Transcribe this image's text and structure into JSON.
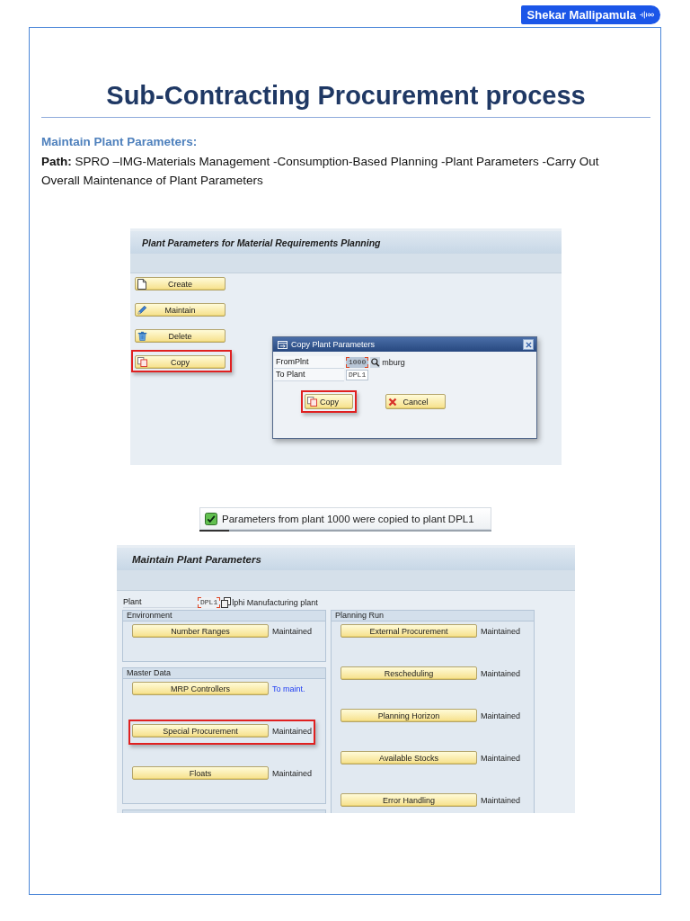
{
  "badge": {
    "text": "Shekar Mallipamula"
  },
  "title": "Sub-Contracting Procurement process",
  "section": {
    "heading": "Maintain Plant Parameters:",
    "path": "**Path:** SPRO –IMG-Materials Management -Consumption-Based Planning -Plant Parameters -Carry Out Overall Maintenance of Plant Parameters"
  },
  "screen_1": {
    "title": "Plant Parameters for Material Requirements Planning",
    "buttons": [
      {
        "label": "Create",
        "kind": "create",
        "highlighted": false
      },
      {
        "label": "Maintain",
        "kind": "maintain",
        "highlighted": false
      },
      {
        "label": "Delete",
        "kind": "delete",
        "highlighted": false
      },
      {
        "label": "Copy",
        "kind": "copy",
        "highlighted": true
      }
    ],
    "dialog": {
      "title": "Copy Plant Parameters",
      "fields": [
        {
          "label": "FromPlnt",
          "value": "1000",
          "focused": true,
          "text_selected": true,
          "value_help": true,
          "description": "mburg"
        },
        {
          "label": "To Plant",
          "value": "DPL1",
          "focused": false,
          "text_selected": false,
          "value_help": false
        }
      ],
      "buttons": [
        {
          "label": "Copy",
          "kind": "copy",
          "highlighted": true
        },
        {
          "label": "Cancel",
          "kind": "cancel",
          "highlighted": false
        }
      ]
    }
  },
  "message": {
    "kind": "success",
    "text": "Parameters from plant 1000 were copied to plant DPL1"
  },
  "screen_2": {
    "title": "Maintain Plant Parameters",
    "plant": {
      "label": "Plant",
      "value": "DPL1",
      "focused": true,
      "text_selected": false,
      "description": "lphi Manufacturing plant"
    },
    "columns": [
      {
        "groups": [
          {
            "title": "Environment",
            "entries": [
              {
                "label": "Number Ranges",
                "status": "Maintained",
                "pending": false,
                "highlighted": false
              }
            ]
          },
          {
            "title": "Master Data",
            "entries": [
              {
                "label": "MRP Controllers",
                "status": "To maint.",
                "pending": true,
                "highlighted": false
              },
              {
                "label": "Special Procurement",
                "status": "Maintained",
                "pending": false,
                "highlighted": true
              },
              {
                "label": "Floats",
                "status": "Maintained",
                "pending": false,
                "highlighted": false
              }
            ]
          }
        ],
        "continues": true
      },
      {
        "groups": [
          {
            "title": "Planning Run",
            "entries": [
              {
                "label": "External Procurement",
                "status": "Maintained",
                "pending": false,
                "highlighted": false
              },
              {
                "label": "Rescheduling",
                "status": "Maintained",
                "pending": false,
                "highlighted": false
              },
              {
                "label": "Planning Horizon",
                "status": "Maintained",
                "pending": false,
                "highlighted": false
              },
              {
                "label": "Available Stocks",
                "status": "Maintained",
                "pending": false,
                "highlighted": false
              },
              {
                "label": "Error Handling",
                "status": "Maintained",
                "pending": false,
                "highlighted": false
              }
            ]
          }
        ],
        "continues": false
      }
    ]
  }
}
